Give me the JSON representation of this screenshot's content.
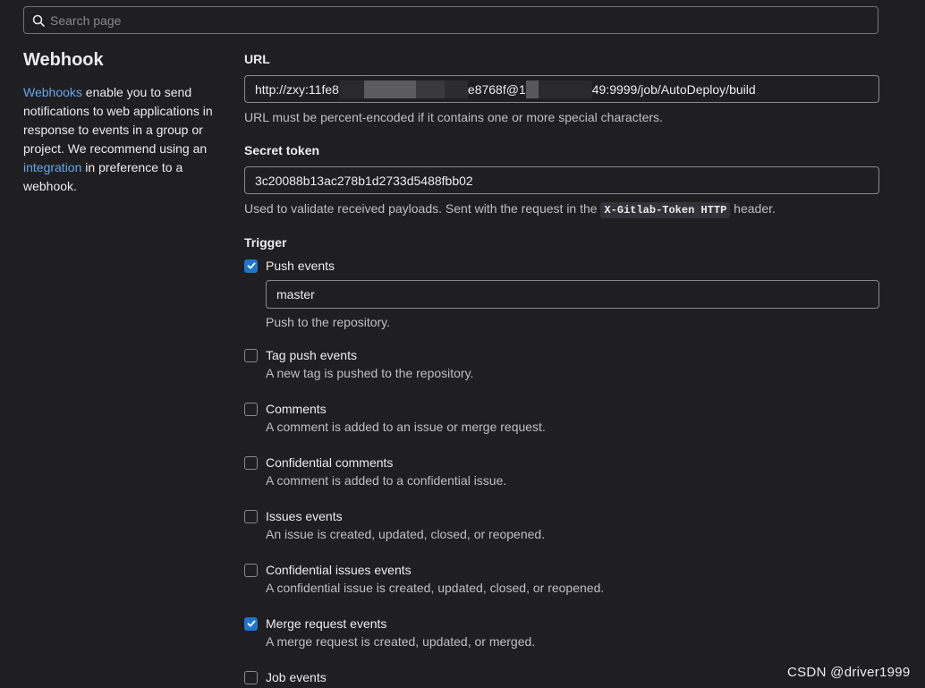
{
  "search": {
    "placeholder": "Search page"
  },
  "sidebar": {
    "title": "Webhook",
    "link1": "Webhooks",
    "text1": " enable you to send notifications to web applications in response to events in a group or project. We recommend using an ",
    "link2": "integration",
    "text2": " in preference to a webhook."
  },
  "url": {
    "label": "URL",
    "value_part1": "http://zxy:11fe8",
    "value_part2": "e8768f@1",
    "value_part3": "49:9999/job/AutoDeploy/build",
    "help": "URL must be percent-encoded if it contains one or more special characters."
  },
  "secret": {
    "label": "Secret token",
    "value": "3c20088b13ac278b1d2733d5488fbb02",
    "help_before": "Used to validate received payloads. Sent with the request in the ",
    "help_code": "X-Gitlab-Token HTTP",
    "help_after": " header."
  },
  "trigger": {
    "label": "Trigger",
    "items": [
      {
        "label": "Push events",
        "checked": true,
        "branch": "master",
        "desc": "Push to the repository."
      },
      {
        "label": "Tag push events",
        "checked": false,
        "desc": "A new tag is pushed to the repository."
      },
      {
        "label": "Comments",
        "checked": false,
        "desc": "A comment is added to an issue or merge request."
      },
      {
        "label": "Confidential comments",
        "checked": false,
        "desc": "A comment is added to a confidential issue."
      },
      {
        "label": "Issues events",
        "checked": false,
        "desc": "An issue is created, updated, closed, or reopened."
      },
      {
        "label": "Confidential issues events",
        "checked": false,
        "desc": "A confidential issue is created, updated, closed, or reopened."
      },
      {
        "label": "Merge request events",
        "checked": true,
        "desc": "A merge request is created, updated, or merged."
      },
      {
        "label": "Job events",
        "checked": false
      }
    ]
  },
  "watermark": "CSDN @driver1999",
  "colors": {
    "background": "#1f1f22",
    "link": "#63a6e9",
    "checkbox_checked": "#1f75cb",
    "border": "#89888d"
  }
}
